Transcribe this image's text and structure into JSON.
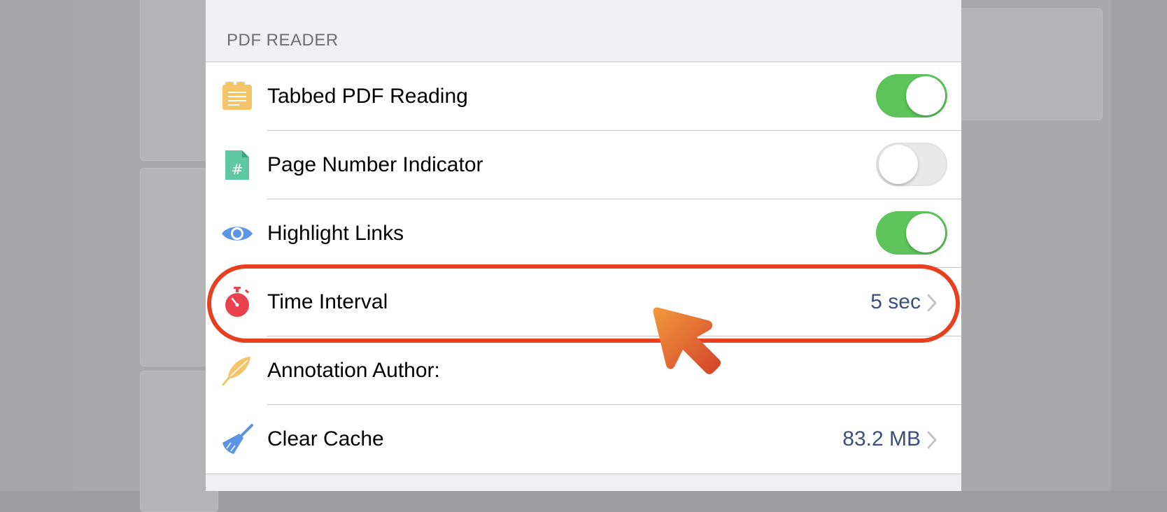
{
  "section": {
    "title": "PDF READER"
  },
  "rows": [
    {
      "icon": "document-lines-icon",
      "label": "Tabbed PDF Reading",
      "control": "toggle",
      "toggle_on": true
    },
    {
      "icon": "page-number-hash-icon",
      "label": "Page Number Indicator",
      "control": "toggle",
      "toggle_on": false
    },
    {
      "icon": "eye-icon",
      "label": "Highlight Links",
      "control": "toggle",
      "toggle_on": true
    },
    {
      "icon": "stopwatch-icon",
      "label": "Time Interval",
      "control": "disclosure",
      "value": "5 sec"
    },
    {
      "icon": "feather-quill-icon",
      "label": "Annotation Author:",
      "control": "none"
    },
    {
      "icon": "broom-icon",
      "label": "Clear Cache",
      "control": "disclosure",
      "value": "83.2 MB"
    }
  ],
  "colors": {
    "toggle_on": "#5cc45b",
    "value_text": "#3c4f7c",
    "highlight_annotation": "#e8401f",
    "panel_background": "#efeff4"
  }
}
